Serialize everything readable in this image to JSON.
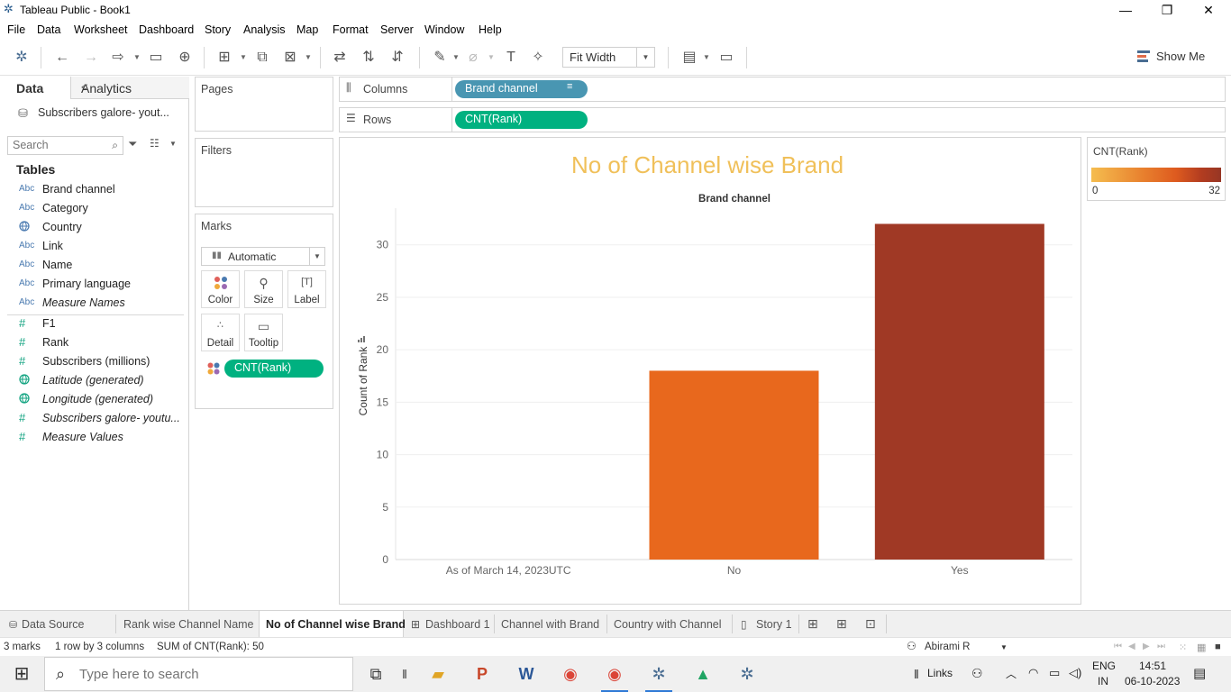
{
  "window": {
    "title": "Tableau Public - Book1",
    "minimize": "—",
    "maximize": "❐",
    "close": "✕"
  },
  "menu": [
    "File",
    "Data",
    "Worksheet",
    "Dashboard",
    "Story",
    "Analysis",
    "Map",
    "Format",
    "Server",
    "Window",
    "Help"
  ],
  "toolbar": {
    "fit": "Fit Width",
    "show_me": "Show Me"
  },
  "left_pane": {
    "tab_data": "Data",
    "tab_analytics": "Analytics",
    "datasource": "Subscribers galore- yout...",
    "search_placeholder": "Search",
    "tables_header": "Tables",
    "dimensions": [
      {
        "type": "Abc",
        "name": "Brand channel",
        "italic": false
      },
      {
        "type": "Abc",
        "name": "Category",
        "italic": false
      },
      {
        "type": "geo",
        "name": "Country",
        "italic": false
      },
      {
        "type": "Abc",
        "name": "Link",
        "italic": false
      },
      {
        "type": "Abc",
        "name": "Name",
        "italic": false
      },
      {
        "type": "Abc",
        "name": "Primary language",
        "italic": false
      },
      {
        "type": "Abc",
        "name": "Measure Names",
        "italic": true
      }
    ],
    "measures": [
      {
        "type": "#",
        "name": "F1",
        "italic": false
      },
      {
        "type": "#",
        "name": "Rank",
        "italic": false
      },
      {
        "type": "#",
        "name": "Subscribers (millions)",
        "italic": false
      },
      {
        "type": "geo",
        "name": "Latitude (generated)",
        "italic": true
      },
      {
        "type": "geo",
        "name": "Longitude (generated)",
        "italic": true
      },
      {
        "type": "#",
        "name": "Subscribers galore- youtu...",
        "italic": true
      },
      {
        "type": "#",
        "name": "Measure Values",
        "italic": true
      }
    ]
  },
  "cards": {
    "pages": "Pages",
    "filters": "Filters",
    "marks": "Marks",
    "mark_type": "Automatic",
    "buttons": {
      "color": "Color",
      "size": "Size",
      "label": "Label",
      "detail": "Detail",
      "tooltip": "Tooltip"
    },
    "marks_pill": "CNT(Rank)"
  },
  "shelves": {
    "columns_label": "Columns",
    "columns_pill": "Brand channel",
    "rows_label": "Rows",
    "rows_pill": "CNT(Rank)"
  },
  "colors": {
    "title": "#f0c05a",
    "pill_dim": "#4996b2",
    "pill_meas": "#00b180",
    "bar_no": "#e8681d",
    "bar_yes": "#a03925"
  },
  "chart_data": {
    "type": "bar",
    "title": "No of Channel wise Brand",
    "xlabel": "Brand channel",
    "ylabel": "Count of Rank",
    "categories": [
      "As of March 14, 2023UTC",
      "No",
      "Yes"
    ],
    "values": [
      0,
      18,
      32
    ],
    "ylim": [
      0,
      32
    ],
    "yticks": [
      0,
      5,
      10,
      15,
      20,
      25,
      30
    ],
    "grid": true
  },
  "legend": {
    "title": "CNT(Rank)",
    "min": "0",
    "max": "32"
  },
  "sheet_tabs": {
    "data_source": "Data Source",
    "tabs": [
      "Rank wise Channel Name",
      "No of Channel wise Brand",
      "Dashboard 1",
      "Channel with Brand",
      "Country with Channel",
      "Story 1"
    ]
  },
  "status": {
    "marks": "3 marks",
    "dims": "1 row by 3 columns",
    "sum": "SUM of CNT(Rank): 50",
    "user": "Abirami R"
  },
  "taskbar": {
    "search_placeholder": "Type here to search",
    "links": "Links",
    "lang_top": "ENG",
    "lang_bottom": "IN",
    "time": "14:51",
    "date": "06-10-2023"
  }
}
